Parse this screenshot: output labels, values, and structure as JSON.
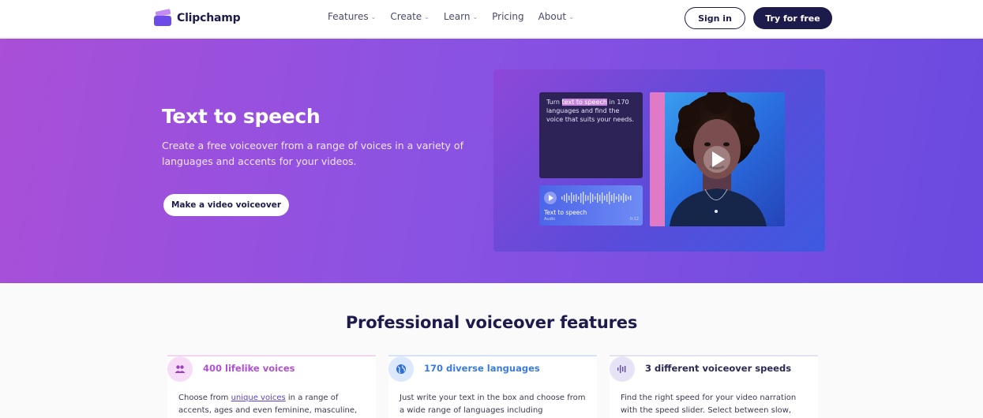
{
  "nav": {
    "logo": "Clipchamp",
    "menu": [
      "Features",
      "Create",
      "Learn",
      "Pricing",
      "About"
    ],
    "sign_in": "Sign in",
    "try_free": "Try for free"
  },
  "hero": {
    "title": "Text to speech",
    "subtitle": "Create a free voiceover from a range of voices in a variety of languages and accents for your videos.",
    "cta": "Make a video voiceover",
    "text_card": {
      "before": "Turn ",
      "highlight": "text to speech",
      "after": " in 170 languages and find the voice that suits your needs."
    },
    "audio_card": {
      "label": "Text to speech",
      "sublabel": "Audio",
      "time": "0:12"
    }
  },
  "features": {
    "title": "Professional voiceover features",
    "cards": [
      {
        "title": "400 lifelike voices",
        "text_before": "Choose from ",
        "link": "unique voices",
        "text_after": " in a range of accents, ages and even feminine, masculine,",
        "accent": "#b14fd8",
        "icon": "people-icon"
      },
      {
        "title": "170 diverse languages",
        "text_before": "Just write your text in the box and choose from a wide range of languages including",
        "link": "",
        "text_after": "",
        "accent": "#3a7be0",
        "icon": "globe-icon"
      },
      {
        "title": "3 different voiceover speeds",
        "text_before": "Find the right speed for your video narration with the speed slider. Select between slow,",
        "link": "",
        "text_after": "",
        "accent": "#2b2a55",
        "icon": "waveform-icon"
      }
    ]
  }
}
